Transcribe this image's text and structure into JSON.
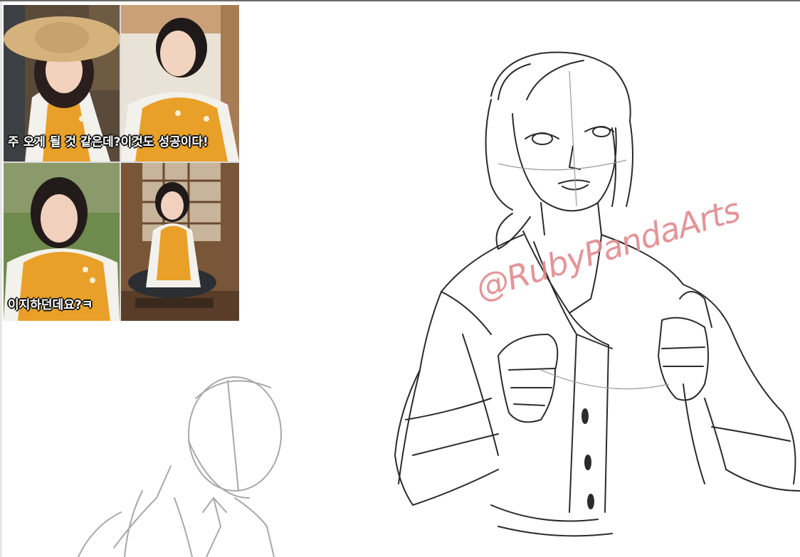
{
  "reference_board": {
    "caption_top": "주 오게 될 것 같은데?이것도 성공이다!",
    "caption_bottom": "이지하던데요?ㅋ"
  },
  "drawing": {
    "watermark": "@RubyPandaArts"
  },
  "colors": {
    "vest_orange": "#e9a028",
    "sketch_line": "#2b2b2b",
    "faint_line": "#a8a8a8",
    "watermark": "#e08a8f"
  }
}
